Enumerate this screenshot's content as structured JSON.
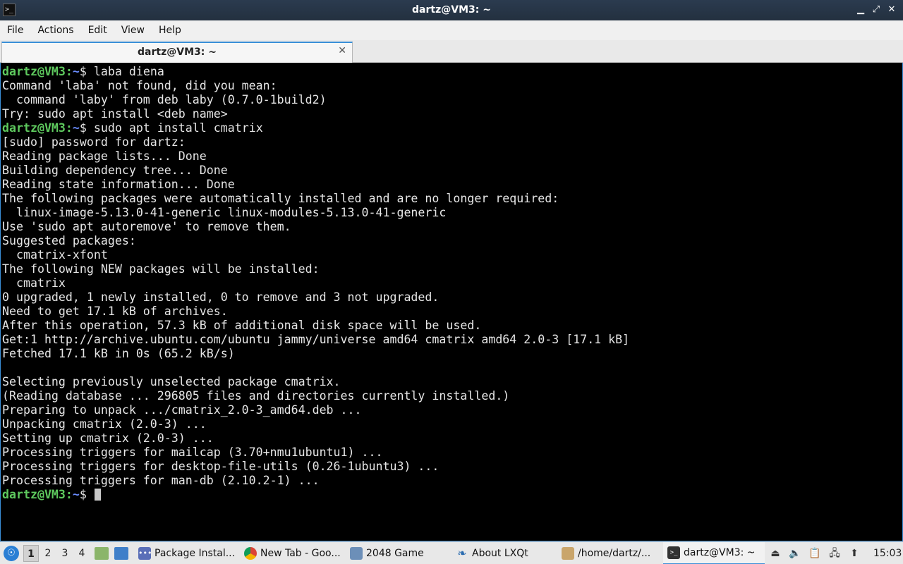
{
  "window": {
    "title": "dartz@VM3: ~",
    "app_icon": ">_",
    "controls": {
      "minimize": "▁",
      "maximize": "⤢",
      "close": "✕"
    }
  },
  "menu": {
    "items": [
      "File",
      "Actions",
      "Edit",
      "View",
      "Help"
    ]
  },
  "tabs": [
    {
      "label": "dartz@VM3: ~",
      "close": "✕"
    }
  ],
  "terminal": {
    "prompt_user": "dartz@VM3",
    "prompt_path": "~",
    "prompt_symbol": "$",
    "lines": [
      {
        "type": "prompt",
        "cmd": " laba diena"
      },
      {
        "type": "out",
        "text": "Command 'laba' not found, did you mean:"
      },
      {
        "type": "out",
        "text": "  command 'laby' from deb laby (0.7.0-1build2)"
      },
      {
        "type": "out",
        "text": "Try: sudo apt install <deb name>"
      },
      {
        "type": "prompt",
        "cmd": " sudo apt install cmatrix"
      },
      {
        "type": "out",
        "text": "[sudo] password for dartz:"
      },
      {
        "type": "out",
        "text": "Reading package lists... Done"
      },
      {
        "type": "out",
        "text": "Building dependency tree... Done"
      },
      {
        "type": "out",
        "text": "Reading state information... Done"
      },
      {
        "type": "out",
        "text": "The following packages were automatically installed and are no longer required:"
      },
      {
        "type": "out",
        "text": "  linux-image-5.13.0-41-generic linux-modules-5.13.0-41-generic"
      },
      {
        "type": "out",
        "text": "Use 'sudo apt autoremove' to remove them."
      },
      {
        "type": "out",
        "text": "Suggested packages:"
      },
      {
        "type": "out",
        "text": "  cmatrix-xfont"
      },
      {
        "type": "out",
        "text": "The following NEW packages will be installed:"
      },
      {
        "type": "out",
        "text": "  cmatrix"
      },
      {
        "type": "out",
        "text": "0 upgraded, 1 newly installed, 0 to remove and 3 not upgraded."
      },
      {
        "type": "out",
        "text": "Need to get 17.1 kB of archives."
      },
      {
        "type": "out",
        "text": "After this operation, 57.3 kB of additional disk space will be used."
      },
      {
        "type": "out",
        "text": "Get:1 http://archive.ubuntu.com/ubuntu jammy/universe amd64 cmatrix amd64 2.0-3 [17.1 kB]"
      },
      {
        "type": "out",
        "text": "Fetched 17.1 kB in 0s (65.2 kB/s)"
      },
      {
        "type": "out",
        "text": ""
      },
      {
        "type": "out",
        "text": "Selecting previously unselected package cmatrix."
      },
      {
        "type": "out",
        "text": "(Reading database ... 296805 files and directories currently installed.)"
      },
      {
        "type": "out",
        "text": "Preparing to unpack .../cmatrix_2.0-3_amd64.deb ..."
      },
      {
        "type": "out",
        "text": "Unpacking cmatrix (2.0-3) ..."
      },
      {
        "type": "out",
        "text": "Setting up cmatrix (2.0-3) ..."
      },
      {
        "type": "out",
        "text": "Processing triggers for mailcap (3.70+nmu1ubuntu1) ..."
      },
      {
        "type": "out",
        "text": "Processing triggers for desktop-file-utils (0.26-1ubuntu3) ..."
      },
      {
        "type": "out",
        "text": "Processing triggers for man-db (2.10.2-1) ..."
      },
      {
        "type": "prompt",
        "cmd": " ",
        "cursor": true
      }
    ]
  },
  "taskbar": {
    "start_icon": "menu-icon",
    "workspaces": [
      "1",
      "2",
      "3",
      "4"
    ],
    "active_workspace": "1",
    "tasks": [
      {
        "label": "Package Instal...",
        "icon": "package-installer-icon",
        "color": "#5a6fb8",
        "active": false
      },
      {
        "label": "New Tab - Goo...",
        "icon": "chrome-icon",
        "color": "#db4437",
        "active": false
      },
      {
        "label": "2048 Game",
        "icon": "game-window-icon",
        "color": "#6c8fb8",
        "active": false
      },
      {
        "label": "About LXQt",
        "icon": "lxqt-icon",
        "color": "#2b6cb0",
        "active": false
      },
      {
        "label": "/home/dartz/...",
        "icon": "folder-icon",
        "color": "#c9a56b",
        "active": false
      },
      {
        "label": "dartz@VM3: ~",
        "icon": "terminal-icon",
        "color": "#333333",
        "active": true
      }
    ],
    "clock": "15:03"
  }
}
